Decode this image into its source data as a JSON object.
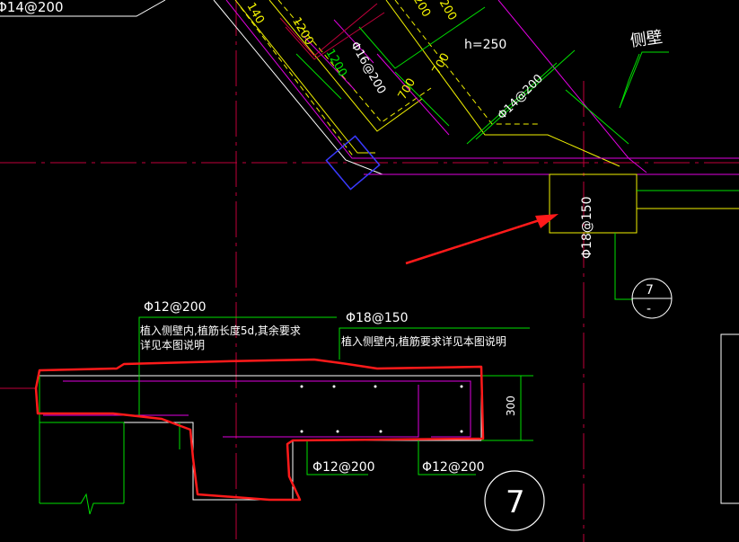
{
  "colors": {
    "background": "#000000",
    "centerline": "#c0003a",
    "white": "#ffffff",
    "yellow": "#f2f200",
    "green": "#00e000",
    "magenta": "#e000e0",
    "blue": "#3a3aff",
    "red": "#ff1a1a"
  },
  "labels": {
    "top_left_rebar": "Φ14@200",
    "dim_1200_a": "1200",
    "dim_1200_b": "1200",
    "dim_700_a": "700",
    "dim_700_b": "700",
    "rebar_16_200": "Φ16@200",
    "rebar_14_200": "Φ14@200",
    "dim_200_a": "200",
    "dim_200_b": "200",
    "dim_140": "140",
    "h_250": "h=250",
    "side_wall": "侧壁",
    "rebar_18_150_vertical": "Φ18@150",
    "detail_ref_top": "7",
    "detail_ref_bottom": "-",
    "note_left_rebar": "Φ12@200",
    "note_left_line1": "植入侧壁内,植筋长度5d,其余要求",
    "note_left_line2": "详见本图说明",
    "note_right_rebar": "Φ18@150",
    "note_right_line1": "植入侧壁内,植筋要求详见本图说明",
    "dim_300": "300",
    "bottom_rebar_left": "Φ12@200",
    "bottom_rebar_right": "Φ12@200",
    "detail_number": "7"
  },
  "icons": {
    "detail_callout": "circle-callout-icon",
    "annotation_arrow": "arrow-icon"
  }
}
